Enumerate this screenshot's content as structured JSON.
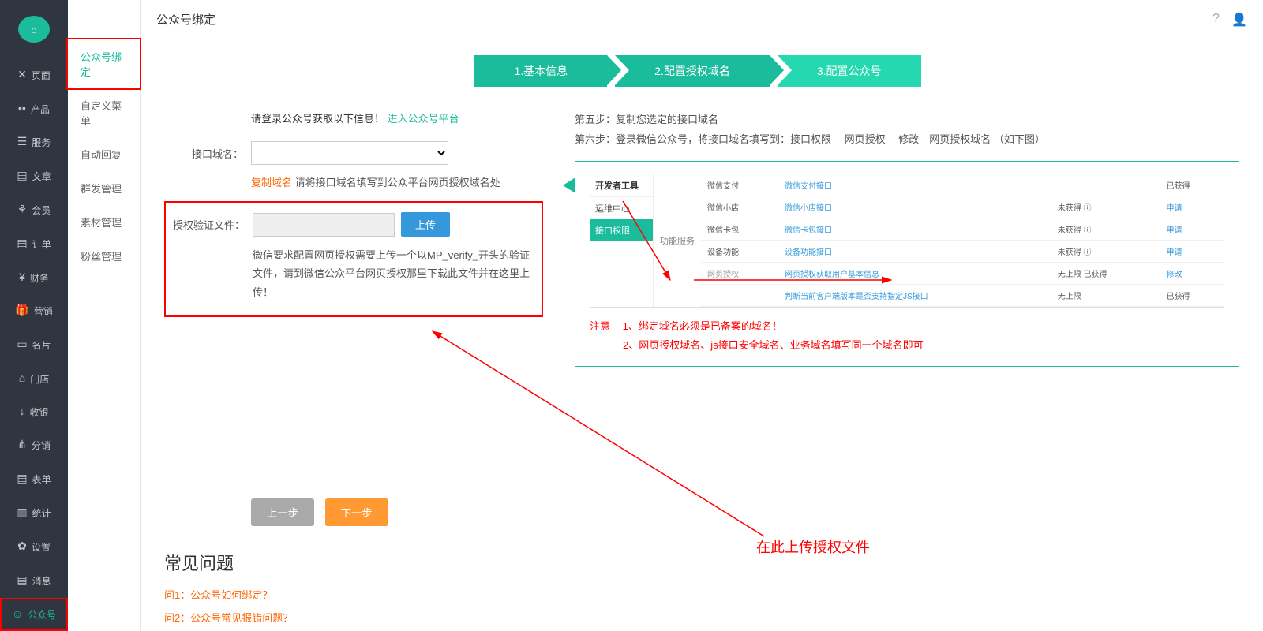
{
  "topbar": {
    "title": "公众号绑定"
  },
  "sidebar": {
    "items": [
      {
        "icon": "✕",
        "label": "页面"
      },
      {
        "icon": "▪▪",
        "label": "产品"
      },
      {
        "icon": "☰",
        "label": "服务"
      },
      {
        "icon": "▤",
        "label": "文章"
      },
      {
        "icon": "⚘",
        "label": "会员"
      },
      {
        "icon": "▤",
        "label": "订单"
      },
      {
        "icon": "¥",
        "label": "财务"
      },
      {
        "icon": "🎁",
        "label": "营销"
      },
      {
        "icon": "▭",
        "label": "名片"
      },
      {
        "icon": "⌂",
        "label": "门店"
      },
      {
        "icon": "↓",
        "label": "收银"
      },
      {
        "icon": "⋔",
        "label": "分销"
      },
      {
        "icon": "▤",
        "label": "表单"
      },
      {
        "icon": "▥",
        "label": "统计"
      },
      {
        "icon": "✿",
        "label": "设置"
      },
      {
        "icon": "▤",
        "label": "消息"
      },
      {
        "icon": "☺",
        "label": "公众号"
      }
    ]
  },
  "subsidebar": {
    "items": [
      "公众号绑定",
      "自定义菜单",
      "自动回复",
      "群发管理",
      "素材管理",
      "粉丝管理"
    ]
  },
  "steps": [
    "1.基本信息",
    "2.配置授权域名",
    "3.配置公众号"
  ],
  "form": {
    "login_prompt": "请登录公众号获取以下信息！",
    "login_link": "进入公众号平台",
    "domain_label": "接口域名：",
    "copy_domain_label": "复制域名",
    "copy_domain_desc": "请将接口域名填写到公众平台网页授权域名处",
    "verify_label": "授权验证文件：",
    "upload_btn": "上传",
    "upload_desc": "微信要求配置网页授权需要上传一个以MP_verify_开头的验证文件，请到微信公众平台网页授权那里下载此文件并在这里上传！"
  },
  "right_steps": {
    "step5": "第五步：复制您选定的接口域名",
    "step6": "第六步：登录微信公众号，将接口域名填写到：接口权限 —网页授权 —修改—网页授权域名 （如下图）"
  },
  "mock": {
    "left_head": "开发者工具",
    "left_items": [
      "运维中心",
      "接口权限"
    ],
    "mid_label": "功能服务",
    "rows": [
      {
        "c1": "微信支付",
        "c2": "微信支付接口",
        "c3": "",
        "c4": "已获得"
      },
      {
        "c1": "微信小店",
        "c2": "微信小店接口",
        "c3": "未获得 ⓘ",
        "c4": "申请"
      },
      {
        "c1": "微信卡包",
        "c2": "微信卡包接口",
        "c3": "未获得 ⓘ",
        "c4": "申请"
      },
      {
        "c1": "设备功能",
        "c2": "设备功能接口",
        "c3": "未获得 ⓘ",
        "c4": "申请"
      },
      {
        "c1": "网页授权",
        "c2": "网页授权获取用户基本信息",
        "c3": "无上限  已获得",
        "c4": "修改"
      },
      {
        "c1": "",
        "c2": "判断当前客户端版本是否支持指定JS接口",
        "c3": "无上限",
        "c4": "已获得"
      }
    ]
  },
  "warning": {
    "label": "注意",
    "line1": "1、绑定域名必须是已备案的域名！",
    "line2": "2、网页授权域名、js接口安全域名、业务域名填写同一个域名即可"
  },
  "buttons": {
    "prev": "上一步",
    "next": "下一步"
  },
  "faq": {
    "title": "常见问题",
    "q1": "问1：公众号如何绑定？",
    "q2": "问2：公众号常见报错问题？"
  },
  "annotation": "在此上传授权文件"
}
